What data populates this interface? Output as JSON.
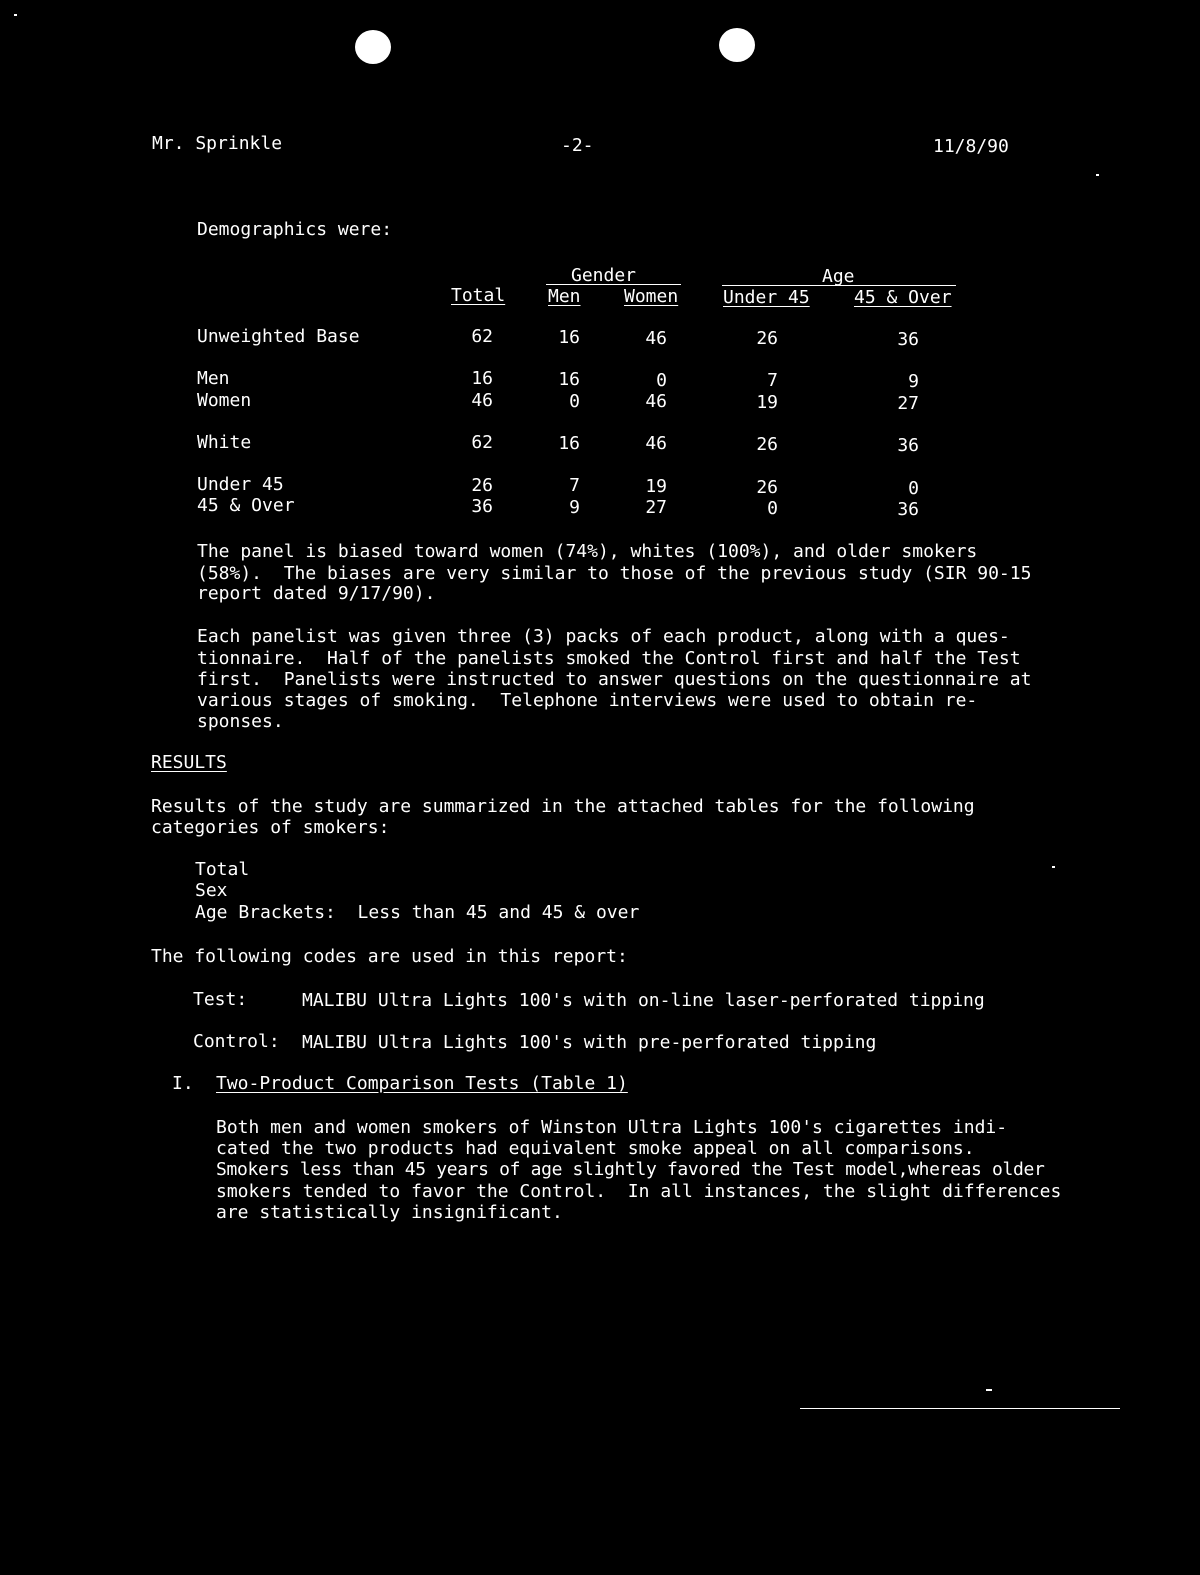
{
  "header": {
    "addressee": "Mr. Sprinkle",
    "page_number": "-2-",
    "date": "11/8/90"
  },
  "intro": "Demographics were:",
  "demographics_table": {
    "group_headers": {
      "gender": "Gender",
      "age": "Age"
    },
    "columns": [
      "Total",
      "Men",
      "Women",
      "Under 45",
      "45 & Over"
    ],
    "rows": [
      {
        "label": "Unweighted Base",
        "values": [
          "62",
          "16",
          "46",
          "26",
          "36"
        ]
      },
      {
        "label": "Men",
        "values": [
          "16",
          "16",
          "0",
          "7",
          "9"
        ]
      },
      {
        "label": "Women",
        "values": [
          "46",
          "0",
          "46",
          "19",
          "27"
        ]
      },
      {
        "label": "White",
        "values": [
          "62",
          "16",
          "46",
          "26",
          "36"
        ]
      },
      {
        "label": "Under 45",
        "values": [
          "26",
          "7",
          "19",
          "26",
          "0"
        ]
      },
      {
        "label": "45 & Over",
        "values": [
          "36",
          "9",
          "27",
          "0",
          "36"
        ]
      }
    ]
  },
  "paragraph_bias": [
    "The panel is biased toward women (74%), whites (100%), and older smokers",
    "(58%).  The biases are very similar to those of the previous study (SIR 90-15",
    "report dated 9/17/90)."
  ],
  "paragraph_method": [
    "Each panelist was given three (3) packs of each product, along with a ques-",
    "tionnaire.  Half of the panelists smoked the Control first and half the Test",
    "first.  Panelists were instructed to answer questions on the questionnaire at",
    "various stages of smoking.  Telephone interviews were used to obtain re-",
    "sponses."
  ],
  "results_heading": "RESULTS",
  "results_intro": [
    "Results of the study are summarized in the attached tables for the following",
    "categories of smokers:"
  ],
  "categories": [
    "Total",
    "Sex",
    "Age Brackets:  Less than 45 and 45 & over"
  ],
  "codes_intro": "The following codes are used in this report:",
  "codes": {
    "test_label": "Test:",
    "test_value": "MALIBU Ultra Lights 100's with on-line laser-perforated tipping",
    "control_label": "Control:",
    "control_value": "MALIBU Ultra Lights 100's with pre-perforated tipping"
  },
  "section_one": {
    "number": "I.",
    "title": "Two-Product Comparison Tests (Table 1)",
    "body": [
      "Both men and women smokers of Winston Ultra Lights 100's cigarettes indi-",
      "cated the two products had equivalent smoke appeal on all comparisons.",
      "Smokers less than 45 years of age slightly favored the Test model,whereas older",
      "smokers tended to favor the Control.  In all instances, the slight differences",
      "are statistically insignificant."
    ]
  }
}
